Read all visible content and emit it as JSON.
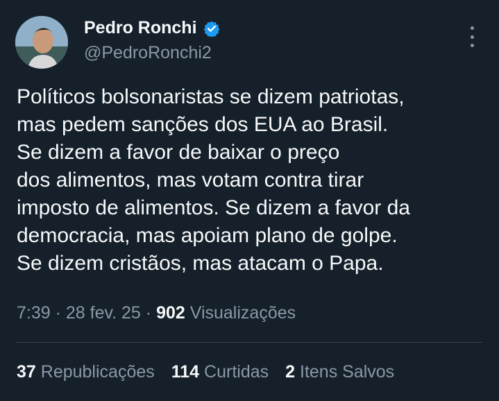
{
  "author": {
    "display_name": "Pedro Ronchi",
    "handle": "@PedroRonchi2",
    "verified_icon": "verified-badge-icon"
  },
  "tweet": {
    "lines": [
      "Políticos bolsonaristas se dizem patriotas,",
      "mas pedem sanções dos EUA ao Brasil.",
      "Se dizem a favor de baixar o preço",
      "dos alimentos, mas votam contra tirar",
      "imposto de alimentos. Se dizem a favor da",
      "democracia, mas apoiam plano de golpe.",
      "Se dizem cristãos, mas atacam o Papa."
    ]
  },
  "meta": {
    "time": "7:39",
    "sep1": " · ",
    "date": "28 fev. 25",
    "sep2": " · ",
    "views_count": "902",
    "views_label": " Visualizações"
  },
  "stats": {
    "reposts_count": "37",
    "reposts_label": " Republicações",
    "likes_count": "114",
    "likes_label": " Curtidas",
    "bookmarks_count": "2",
    "bookmarks_label": " Itens Salvos"
  },
  "colors": {
    "background": "#15202b",
    "text": "#f7f9f9",
    "secondary": "#8b98a5",
    "verified": "#1d9bf0"
  }
}
